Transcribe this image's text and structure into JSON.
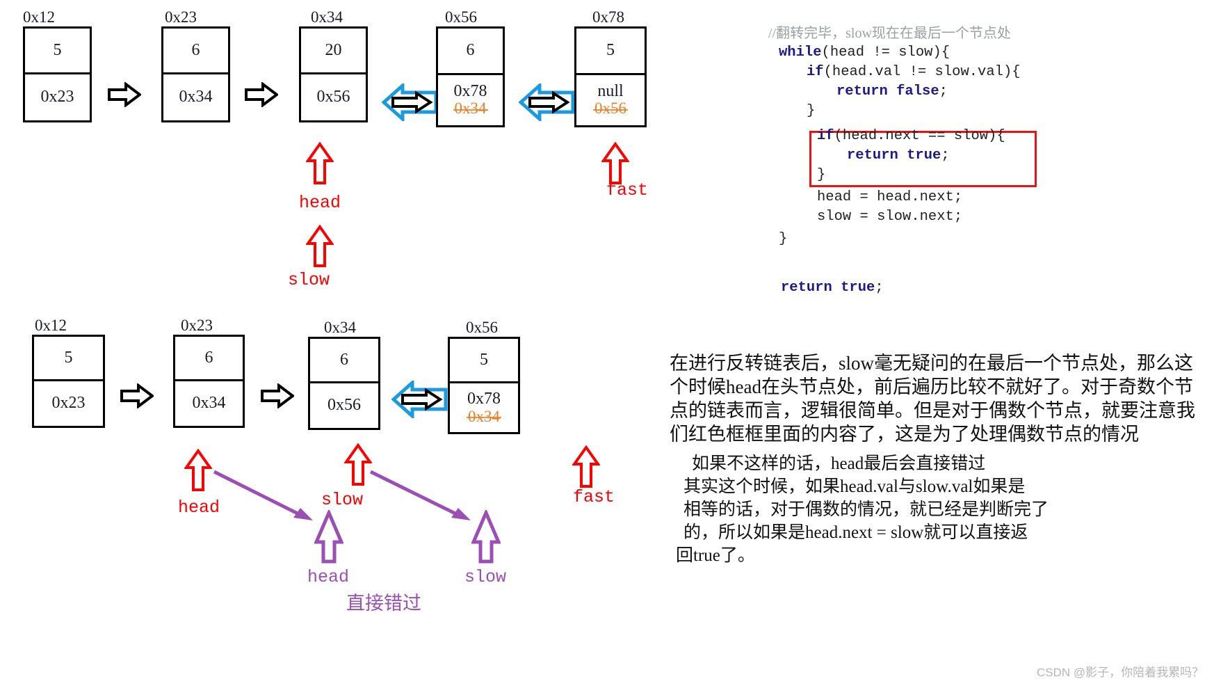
{
  "diagram": {
    "row1": {
      "nodes": [
        {
          "addr": "0x12",
          "val": "5",
          "next": "0x23",
          "old_next": ""
        },
        {
          "addr": "0x23",
          "val": "6",
          "next": "0x34",
          "old_next": ""
        },
        {
          "addr": "0x34",
          "val": "20",
          "next": "0x56",
          "old_next": ""
        },
        {
          "addr": "0x56",
          "val": "6",
          "next": "0x78",
          "old_next": "0x34"
        },
        {
          "addr": "0x78",
          "val": "5",
          "next": "null",
          "old_next": "0x56"
        }
      ],
      "pointers": [
        {
          "name": "head",
          "color": "#ff0000"
        },
        {
          "name": "slow",
          "color": "#ff0000"
        },
        {
          "name": "fast",
          "color": "#ff0000"
        }
      ]
    },
    "row2": {
      "nodes": [
        {
          "addr": "0x12",
          "val": "5",
          "next": "0x23",
          "old_next": ""
        },
        {
          "addr": "0x23",
          "val": "6",
          "next": "0x34",
          "old_next": ""
        },
        {
          "addr": "0x34",
          "val": "6",
          "next": "0x56",
          "old_next": ""
        },
        {
          "addr": "0x56",
          "val": "5",
          "next": "0x78",
          "old_next": "0x34"
        }
      ],
      "pointers_red": [
        {
          "name": "head"
        },
        {
          "name": "slow"
        },
        {
          "name": "fast"
        }
      ],
      "pointers_purple": [
        {
          "name": "head"
        },
        {
          "name": "slow"
        }
      ],
      "caption": "直接错过"
    }
  },
  "code": {
    "comment": "//翻转完毕，slow现在在最后一个节点处",
    "lines": [
      {
        "indent": 0,
        "kw": "while",
        "rest": "(head != slow){"
      },
      {
        "indent": 1,
        "kw": "if",
        "rest": "(head.val != slow.val){"
      },
      {
        "indent": 2,
        "kw": "return false",
        "rest": ";"
      },
      {
        "indent": 1,
        "kw": "",
        "rest": "}"
      },
      {
        "indent": 1,
        "kw": "if",
        "rest": "(head.next == slow){"
      },
      {
        "indent": 2,
        "kw": "return true",
        "rest": ";"
      },
      {
        "indent": 1,
        "kw": "",
        "rest": "}"
      },
      {
        "indent": 1,
        "kw": "",
        "rest": "head = head.next;"
      },
      {
        "indent": 1,
        "kw": "",
        "rest": "slow = slow.next;"
      },
      {
        "indent": 0,
        "kw": "",
        "rest": "}"
      }
    ],
    "tail_kw": "return true",
    "tail_rest": ";",
    "highlight_color": "#ee1111"
  },
  "note": {
    "para1_line1": "在进行反转链表后，slow毫无疑问的在最后一个节点处，那么这",
    "para1_line2": "个时候head在头节点处，前后遍历比较不就好了。对于奇数个节",
    "para1_line3": "点的链表而言，逻辑很简单。但是对于偶数个节点，就要注意我",
    "para1_line4": "们红色框框里面的内容了，这是为了处理偶数节点的情况",
    "para2_line1": "如果不这样的话，head最后会直接错过",
    "para2_line2": "其实这个时候，如果head.val与slow.val如果是",
    "para2_line3": "相等的话，对于偶数的情况，就已经是判断完了",
    "para2_line4": "的，所以如果是head.next = slow就可以直接返",
    "para2_line5": "回true了。"
  },
  "watermark": "CSDN @影子，你陪着我累吗？"
}
